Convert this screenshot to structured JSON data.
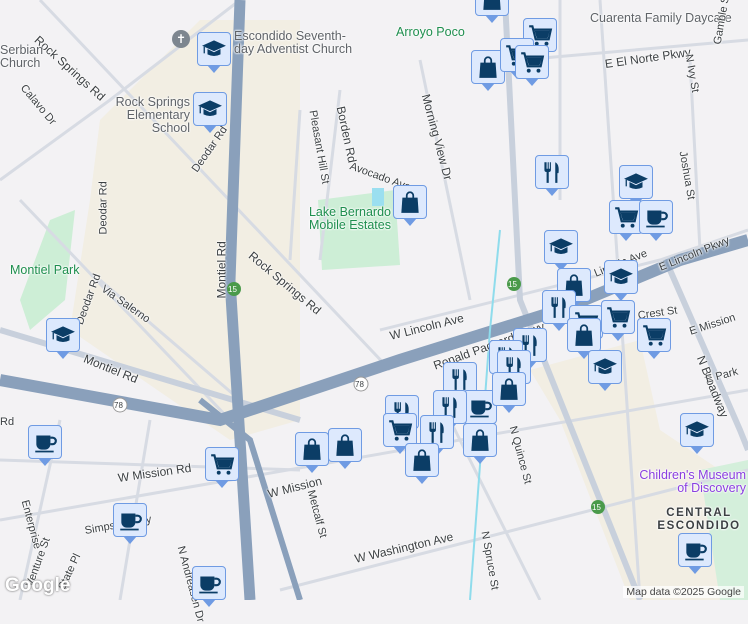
{
  "map": {
    "labels": {
      "rock_springs_rd_1": "Rock Springs Rd",
      "rock_springs_rd_2": "Rock Springs Rd",
      "serbian_church": "Serbian Church",
      "calavo_dr": "Calavo Dr",
      "church": "Escondido Seventh-day Adventist Church",
      "arroyo_poco": "Arroyo Poco",
      "daycare": "Cuarenta Family Daycare",
      "rock_springs_school": "Rock Springs Elementary School",
      "deodar_rd_1": "Deodar Rd",
      "deodar_rd_2": "Deodar Rd",
      "deodar_rd_3": "Deodar Rd",
      "pleasant_hill_st": "Pleasant Hill St",
      "borden_rd": "Borden Rd",
      "avocado": "Avocado Ave",
      "morning_view_dr": "Morning View Dr",
      "e_el_norte_pkwy": "E El Norte Pkwy",
      "n_ivy_st": "N Ivy St",
      "gamble_st": "Gamble St",
      "joshua_st": "Joshua St",
      "lake_bernardo": "Lake Bernardo Mobile Estates",
      "montiel_park": "Montiel Park",
      "montiel_rd_1": "Montiel Rd",
      "montiel_rd_2": "Montiel Rd",
      "via_salerno": "Via Salerno",
      "w_lincoln_ave": "W Lincoln Ave",
      "e_lincoln_pkwy": "E Lincoln Pkwy",
      "lincoln_ave": "Lincoln Ave",
      "ronald_packard": "Ronald Packard Pkwy",
      "crest_st": "Crest St",
      "e_mission": "E Mission",
      "n_broadway": "N Broadway",
      "e_park": "E Park",
      "w_mission_rd_1": "W Mission Rd",
      "w_mission_rd_2": "W Mission",
      "metcalf_st": "Metcalf St",
      "n_quince_st": "N Quince St",
      "n_spruce_st": "N Spruce St",
      "w_washington_ave": "W Washington Ave",
      "enterprise": "Enterprise",
      "venture_st": "Venture St",
      "simpson_way": "Simpson Way",
      "n_andreasen_dr": "N Andreasen Dr",
      "state_pl": "State Pl",
      "childrens_museum": "Children's Museum of Discovery",
      "central_escondido": "CENTRAL ESCONDIDO",
      "rd_left": "Rd",
      "hwy_15_a": "15",
      "hwy_15_b": "15",
      "hwy_15_c": "15",
      "hwy_78_a": "78",
      "hwy_78_b": "78"
    },
    "attribution": "Map data ©2025 Google",
    "logo": "Google",
    "colors": {
      "marker_fill": "#dde9fd",
      "marker_border": "#6f9be3",
      "icon": "#0b3d66",
      "freeway": "#8aa0bb",
      "park": "#cdeed6",
      "sand": "#f2eee3"
    }
  },
  "markers": [
    {
      "type": "school"
    },
    {
      "type": "school"
    },
    {
      "type": "shopping"
    },
    {
      "type": "shopping"
    },
    {
      "type": "grocery"
    },
    {
      "type": "grocery"
    },
    {
      "type": "grocery"
    },
    {
      "type": "restaurant"
    },
    {
      "type": "school"
    },
    {
      "type": "grocery"
    },
    {
      "type": "cafe"
    },
    {
      "type": "shopping"
    },
    {
      "type": "school"
    },
    {
      "type": "shopping"
    },
    {
      "type": "school"
    },
    {
      "type": "restaurant"
    },
    {
      "type": "grocery"
    },
    {
      "type": "grocery"
    },
    {
      "type": "shopping"
    },
    {
      "type": "grocery"
    },
    {
      "type": "school"
    },
    {
      "type": "restaurant"
    },
    {
      "type": "restaurant"
    },
    {
      "type": "restaurant"
    },
    {
      "type": "restaurant"
    },
    {
      "type": "cafe"
    },
    {
      "type": "restaurant"
    },
    {
      "type": "shopping"
    },
    {
      "type": "restaurant"
    },
    {
      "type": "grocery"
    },
    {
      "type": "restaurant"
    },
    {
      "type": "shopping"
    },
    {
      "type": "shopping"
    },
    {
      "type": "shopping"
    },
    {
      "type": "shopping"
    },
    {
      "type": "school"
    },
    {
      "type": "cafe"
    },
    {
      "type": "grocery"
    },
    {
      "type": "cafe"
    },
    {
      "type": "cafe"
    },
    {
      "type": "school"
    },
    {
      "type": "cafe"
    }
  ]
}
